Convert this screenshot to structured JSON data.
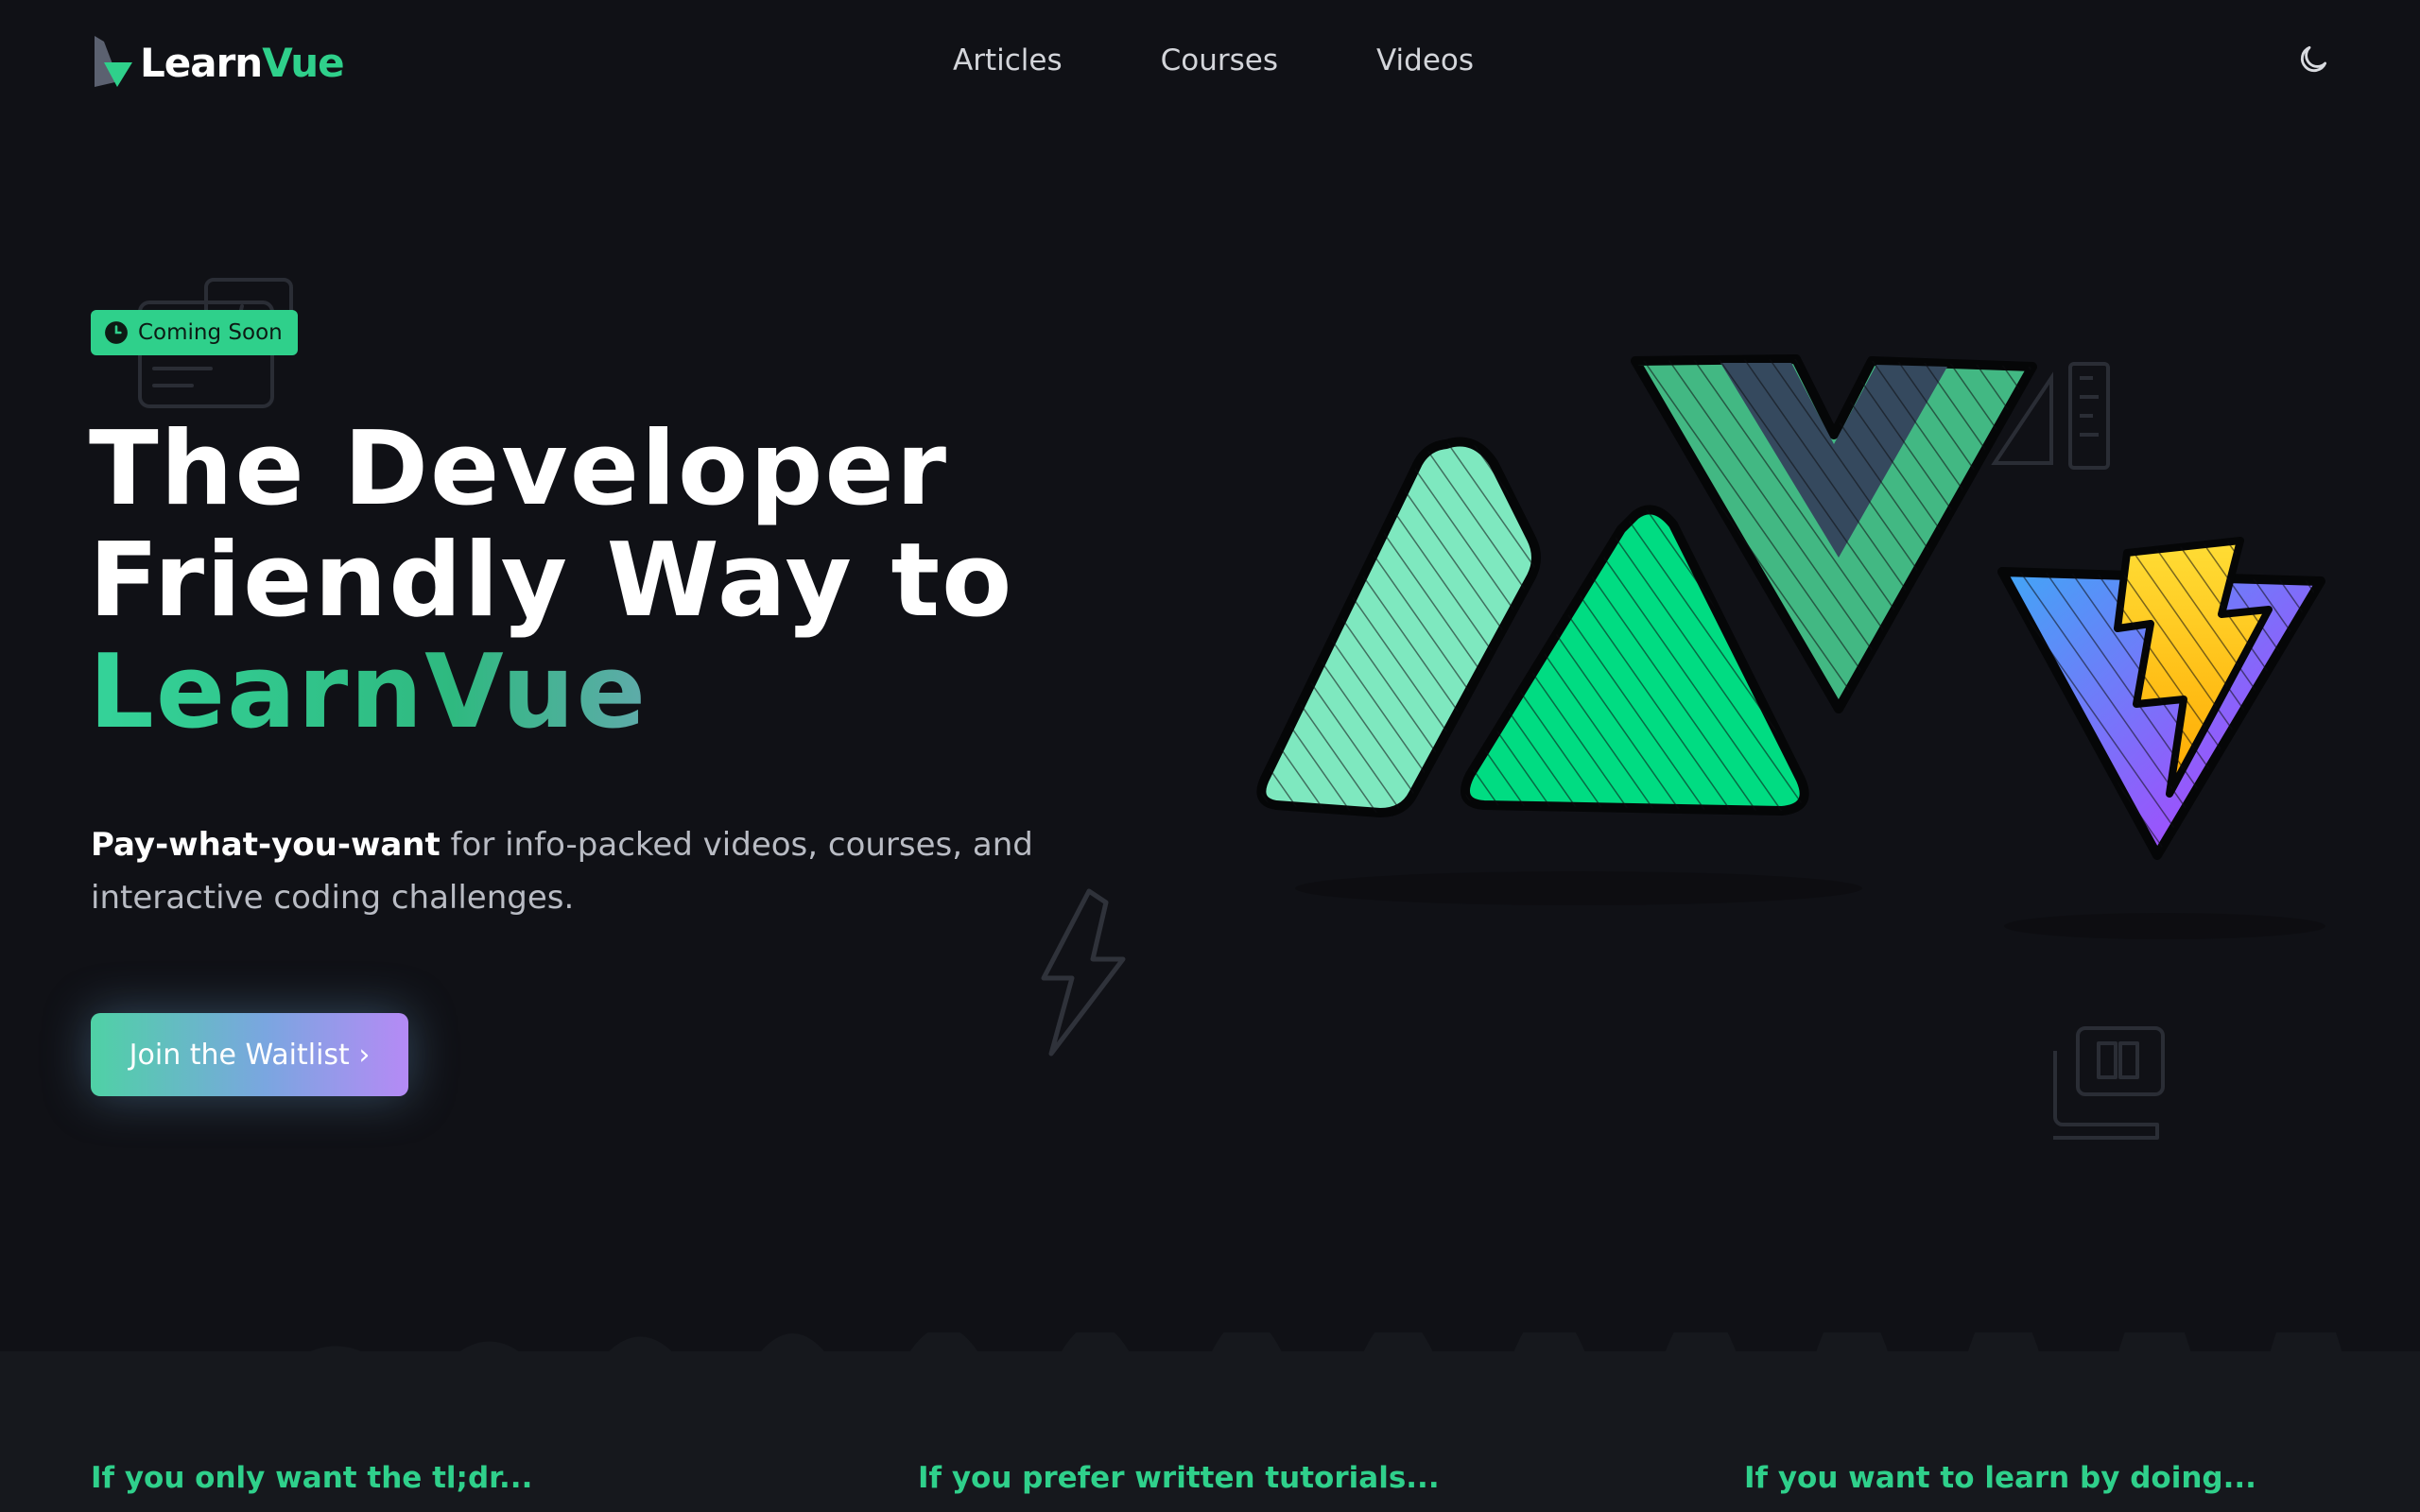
{
  "brand": {
    "learn": "Learn",
    "vue": "Vue"
  },
  "nav": [
    {
      "label": "Articles"
    },
    {
      "label": "Courses"
    },
    {
      "label": "Videos"
    }
  ],
  "theme_toggle": {
    "icon": "moon-icon"
  },
  "hero": {
    "badge": "Coming Soon",
    "title_line1": "The Developer",
    "title_line2": "Friendly Way to",
    "title_line3": "LearnVue",
    "subtitle_bold": "Pay-what-you-want",
    "subtitle_rest": " for info-packed videos, courses, and interactive coding challenges.",
    "cta": "Join the Waitlist ›"
  },
  "features": [
    {
      "label": "If you only want the tl;dr..."
    },
    {
      "label": "If you prefer written tutorials..."
    },
    {
      "label": "If you want to learn by doing..."
    }
  ],
  "colors": {
    "background": "#101116",
    "accent_green": "#2fd08b",
    "accent_purple": "#a78bfa",
    "band": "#16181d"
  }
}
